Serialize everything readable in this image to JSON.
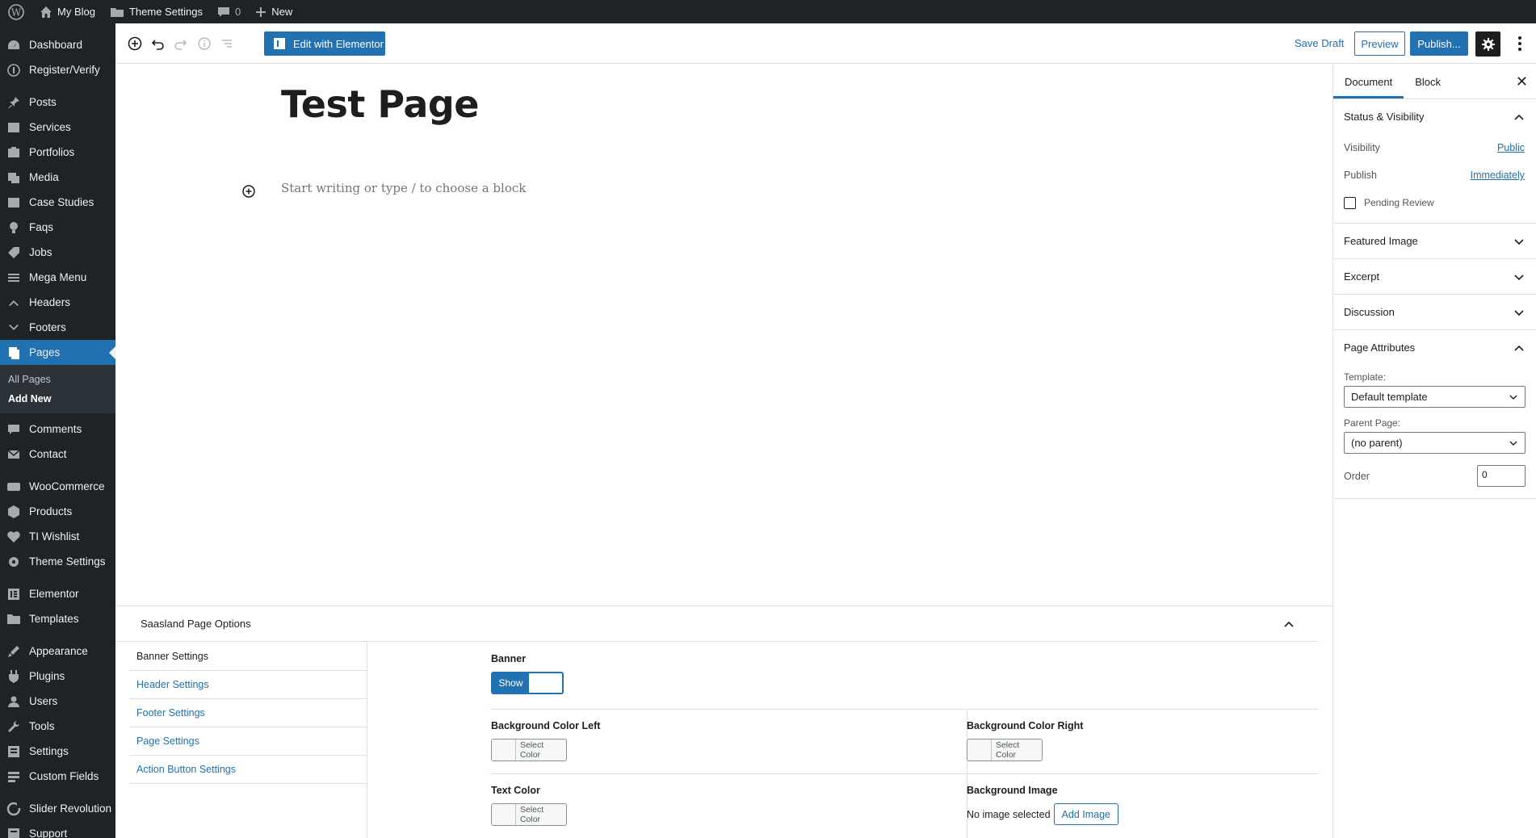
{
  "admin_bar": {
    "site_name": "My Blog",
    "theme_settings": "Theme Settings",
    "comments_count": "0",
    "new_label": "New"
  },
  "sidebar": {
    "items": [
      {
        "label": "Dashboard",
        "icon": "dashboard-icon"
      },
      {
        "label": "Register/Verify",
        "icon": "register-icon"
      },
      {
        "label": "Posts",
        "icon": "pin-icon"
      },
      {
        "label": "Services",
        "icon": "services-icon"
      },
      {
        "label": "Portfolios",
        "icon": "portfolio-icon"
      },
      {
        "label": "Media",
        "icon": "media-icon"
      },
      {
        "label": "Case Studies",
        "icon": "case-study-icon"
      },
      {
        "label": "Faqs",
        "icon": "faq-icon"
      },
      {
        "label": "Jobs",
        "icon": "jobs-icon"
      },
      {
        "label": "Mega Menu",
        "icon": "menu-icon"
      },
      {
        "label": "Headers",
        "icon": "headers-icon"
      },
      {
        "label": "Footers",
        "icon": "footers-icon"
      },
      {
        "label": "Pages",
        "icon": "pages-icon"
      },
      {
        "label": "Comments",
        "icon": "comments-icon"
      },
      {
        "label": "Contact",
        "icon": "mail-icon"
      },
      {
        "label": "WooCommerce",
        "icon": "woocommerce-icon"
      },
      {
        "label": "Products",
        "icon": "products-icon"
      },
      {
        "label": "TI Wishlist",
        "icon": "wishlist-icon"
      },
      {
        "label": "Theme Settings",
        "icon": "gear-icon"
      },
      {
        "label": "Elementor",
        "icon": "elementor-icon"
      },
      {
        "label": "Templates",
        "icon": "folder-icon"
      },
      {
        "label": "Appearance",
        "icon": "appearance-icon"
      },
      {
        "label": "Plugins",
        "icon": "plugin-icon"
      },
      {
        "label": "Users",
        "icon": "users-icon"
      },
      {
        "label": "Tools",
        "icon": "tools-icon"
      },
      {
        "label": "Settings",
        "icon": "settings-icon"
      },
      {
        "label": "Custom Fields",
        "icon": "custom-fields-icon"
      },
      {
        "label": "Slider Revolution",
        "icon": "slider-icon"
      },
      {
        "label": "Support",
        "icon": "support-icon"
      }
    ],
    "submenu": {
      "all_pages": "All Pages",
      "add_new": "Add New"
    }
  },
  "toolbar": {
    "edit_with_elementor": "Edit with Elementor",
    "save_draft": "Save Draft",
    "preview": "Preview",
    "publish": "Publish..."
  },
  "editor": {
    "title": "Test Page",
    "placeholder": "Start writing or type / to choose a block"
  },
  "settings_sidebar": {
    "tabs": [
      "Document",
      "Block"
    ],
    "status_visibility": {
      "title": "Status & Visibility",
      "visibility_label": "Visibility",
      "visibility_value": "Public",
      "publish_label": "Publish",
      "publish_value": "Immediately",
      "pending_review": "Pending Review"
    },
    "featured_image": "Featured Image",
    "excerpt": "Excerpt",
    "discussion": "Discussion",
    "page_attributes": {
      "title": "Page Attributes",
      "template_label": "Template:",
      "template_value": "Default template",
      "parent_label": "Parent Page:",
      "parent_value": "(no parent)",
      "order_label": "Order",
      "order_value": "0"
    }
  },
  "metabox": {
    "title": "Saasland Page Options",
    "tabs": [
      "Banner Settings",
      "Header Settings",
      "Footer Settings",
      "Page Settings",
      "Action Button Settings"
    ],
    "banner_label": "Banner",
    "banner_toggle": "Show",
    "bg_left_label": "Background Color Left",
    "bg_right_label": "Background Color Right",
    "text_color_label": "Text Color",
    "bg_image_label": "Background Image",
    "select_color": "Select Color",
    "no_image": "No image selected",
    "add_image": "Add Image"
  },
  "colors": {
    "admin_dark": "#1d2327",
    "accent": "#2271b1"
  }
}
